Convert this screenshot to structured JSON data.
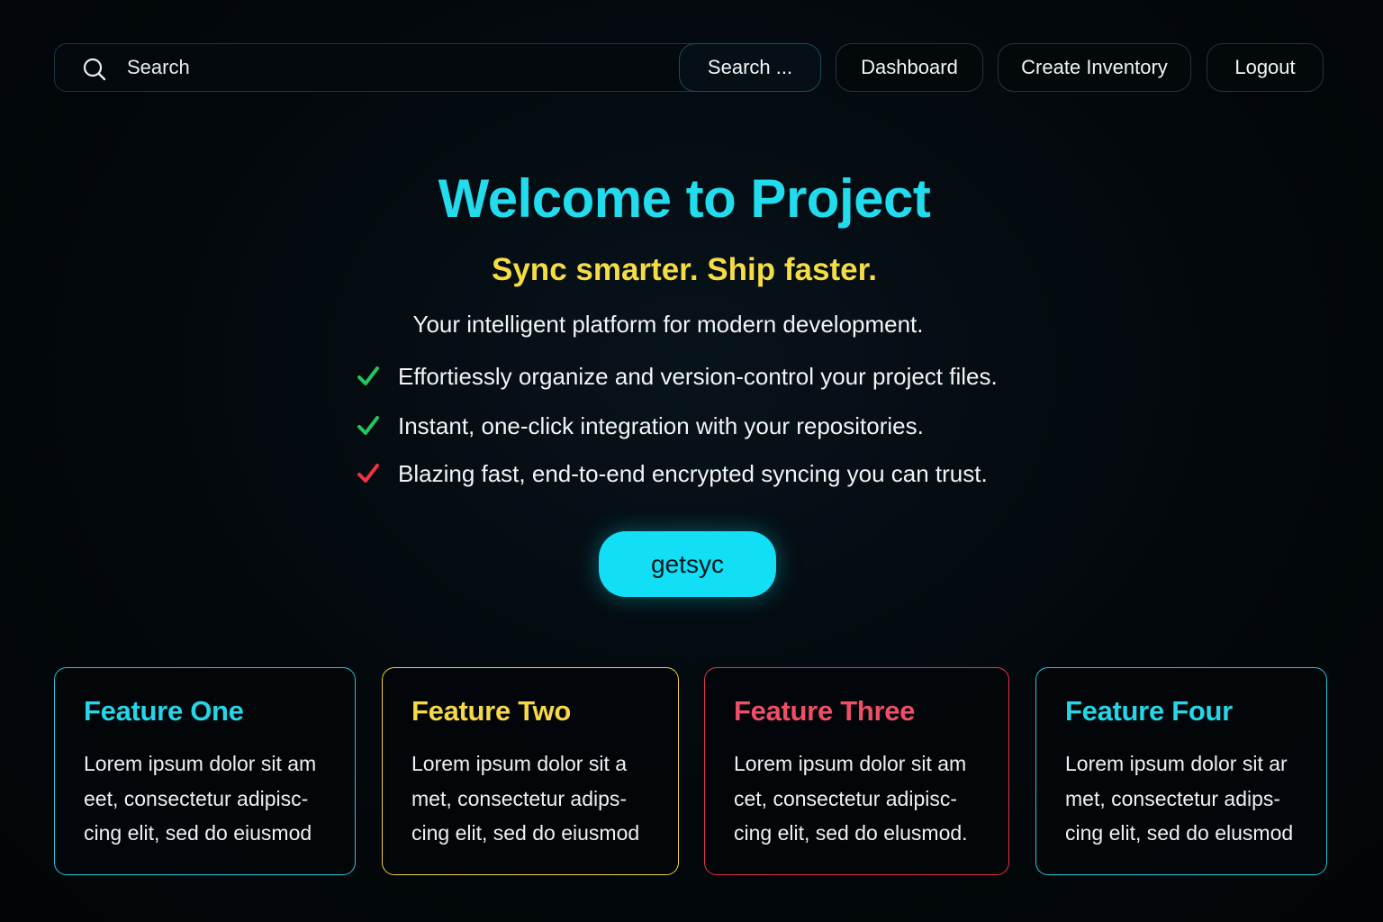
{
  "search": {
    "placeholder": "Search",
    "icon": "search-icon"
  },
  "nav": {
    "search_label": "Search ...",
    "dashboard_label": "Dashboard",
    "create_label": "Create Inventory",
    "logout_label": "Logout"
  },
  "hero": {
    "title": "Welcome to Project",
    "subtitle": "Sync smarter. Ship faster.",
    "description": "Your intelligent platform for modern development.",
    "bullets": [
      {
        "text": "Effortiessly organize and version-control your project files.",
        "icon": "check-icon",
        "color": "#22c55e"
      },
      {
        "text": "Instant, one-click integration with your repositories.",
        "icon": "check-icon",
        "color": "#22c55e"
      },
      {
        "text": "Blazing fast, end-to-end encrypted syncing you can trust.",
        "icon": "check-icon",
        "color": "#ef3340"
      }
    ],
    "cta_label": "getsyc"
  },
  "features": [
    {
      "title": "Feature One",
      "lines": [
        "Lorem ipsum dolor sit am",
        "eet, consectetur adipisc-",
        "cing elit, sed do eiusmod"
      ],
      "color": "#23c6d6"
    },
    {
      "title": "Feature Two",
      "lines": [
        "Lorem ipsum dolor sit a",
        "met, consectetur adips-",
        "cing elit, sed do eiusmod"
      ],
      "color": "#f0cf3e"
    },
    {
      "title": "Feature Three",
      "lines": [
        "Lorem ipsum dolor sit am",
        "cet, consectetur adipisc-",
        "cing elit, sed do elusmod."
      ],
      "color": "#e73447"
    },
    {
      "title": "Feature Four",
      "lines": [
        "Lorem ipsum dolor sit ar",
        "met, consectetur adips-",
        "cing elit, sed do elusmod"
      ],
      "color": "#23c6d6"
    }
  ],
  "colors": {
    "background": "#03080c",
    "accent_cyan": "#22dced",
    "accent_yellow": "#f5dc45",
    "accent_red": "#e73447",
    "cta": "#12dff5"
  }
}
